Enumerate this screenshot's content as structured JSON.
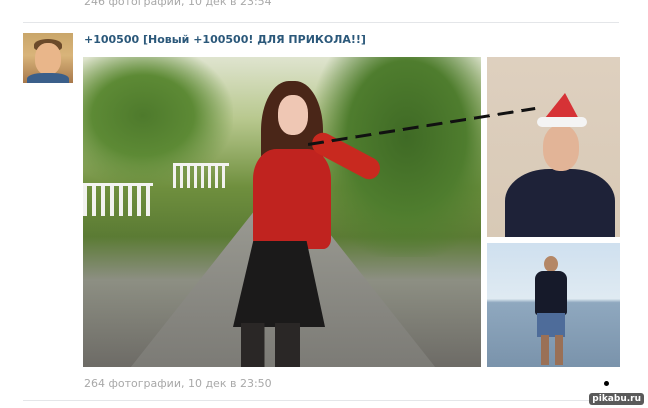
{
  "previous_post": {
    "meta": "246 фотографии, 10 дек в 23:54"
  },
  "post": {
    "title": "+100500 [Новый +100500! ДЛЯ ПРИКОЛА!!]",
    "meta": "264 фотографии, 10 дек в 23:50"
  },
  "watermark": "pikabu.ru",
  "colors": {
    "link": "#2b587a",
    "meta": "#a8a8a8",
    "divider": "#e4e6e9"
  }
}
